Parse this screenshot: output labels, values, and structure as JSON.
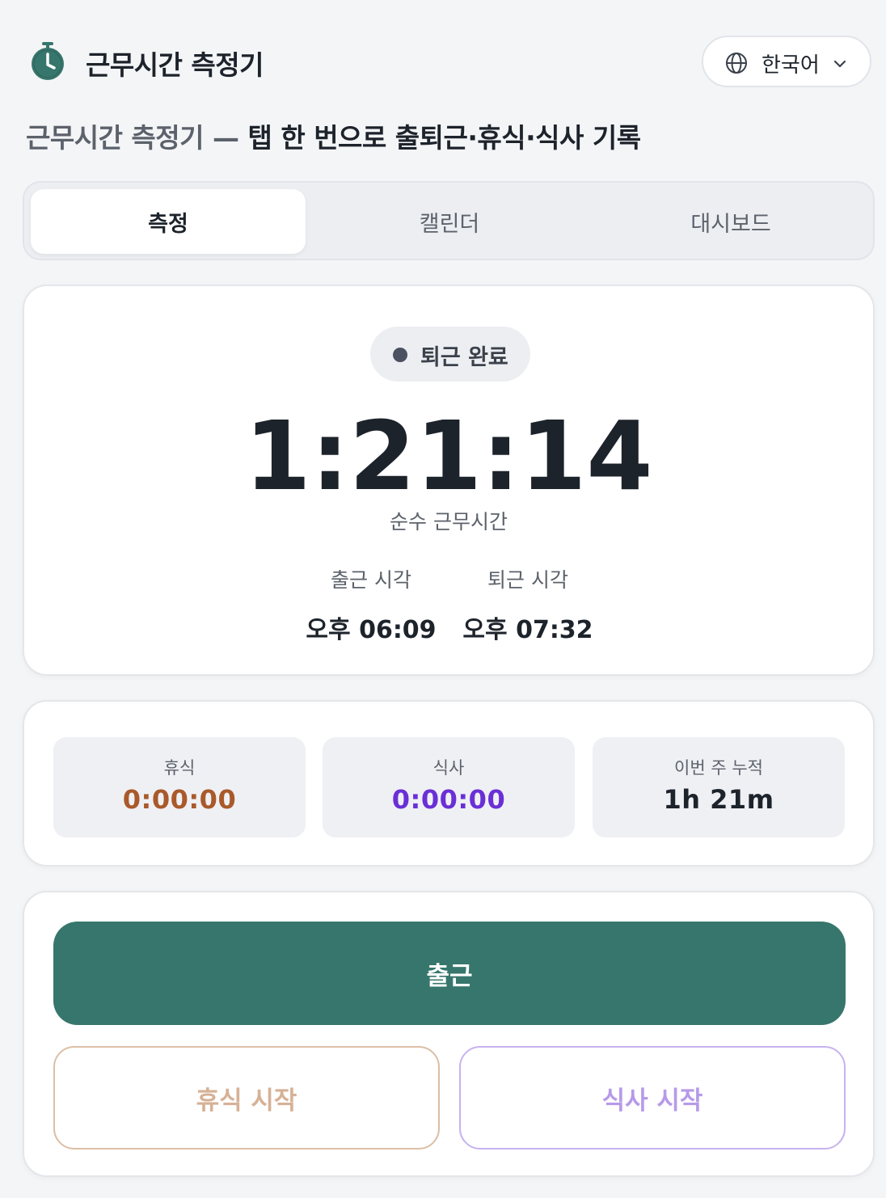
{
  "header": {
    "app_title": "근무시간 측정기",
    "language": "한국어"
  },
  "subtitle": {
    "prefix": "근무시간 측정기 — ",
    "main": "탭 한 번으로 출퇴근·휴식·식사 기록"
  },
  "tabs": [
    {
      "label": "측정",
      "active": true
    },
    {
      "label": "캘린더",
      "active": false
    },
    {
      "label": "대시보드",
      "active": false
    }
  ],
  "timer": {
    "status": "퇴근 완료",
    "elapsed": "1:21:14",
    "elapsed_label": "순수 근무시간",
    "clock_in_label": "출근 시각",
    "clock_in_value": "오후 06:09",
    "clock_out_label": "퇴근 시각",
    "clock_out_value": "오후 07:32"
  },
  "stats": [
    {
      "label": "휴식",
      "value": "0:00:00",
      "color": "#a9592a"
    },
    {
      "label": "식사",
      "value": "0:00:00",
      "color": "#6a2fd6"
    },
    {
      "label": "이번 주 누적",
      "value": "1h 21m",
      "color": "#1d232b"
    }
  ],
  "actions": {
    "clock_in": "출근",
    "break_start": "휴식 시작",
    "meal_start": "식사 시작"
  },
  "colors": {
    "primary": "#37766c",
    "break_accent": "#d6b196",
    "meal_accent": "#b79ae9",
    "status_dot": "#4a5160"
  },
  "icons": {
    "app": "stopwatch-icon",
    "language": "globe-icon",
    "dropdown": "chevron-down-icon",
    "status": "status-dot-icon"
  }
}
